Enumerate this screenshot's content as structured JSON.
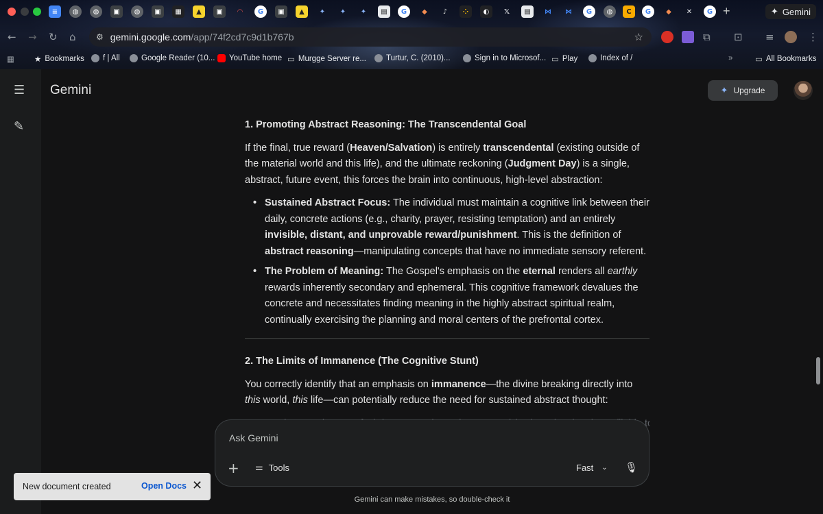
{
  "browser": {
    "active_tab_title": "Gemini",
    "url_host": "gemini.google.com",
    "url_path": "/app/74f2cd7c9d1b767b",
    "bookmarks": [
      {
        "label": "Bookmarks",
        "icon": "star-icon"
      },
      {
        "label": "f | All",
        "icon": "globe-icon"
      },
      {
        "label": "Google Reader (10...",
        "icon": "globe-icon"
      },
      {
        "label": "YouTube home",
        "icon": "youtube-icon"
      },
      {
        "label": "Murgge Server re...",
        "icon": "folder-icon"
      },
      {
        "label": "Turtur, C. (2010)...",
        "icon": "globe-icon"
      },
      {
        "label": "Sign in to Microsof...",
        "icon": "globe-icon"
      },
      {
        "label": "Play",
        "icon": "folder-icon"
      },
      {
        "label": "Index of /",
        "icon": "globe-icon"
      }
    ],
    "all_bookmarks_label": "All Bookmarks"
  },
  "app": {
    "brand": "Gemini",
    "upgrade_label": "Upgrade"
  },
  "response": {
    "section1": {
      "heading": "1. Promoting Abstract Reasoning: The Transcendental Goal",
      "p_a": "If the final, true reward (",
      "p_b": "Heaven/Salvation",
      "p_c": ") is entirely ",
      "p_d": "transcendental",
      "p_e": " (existing outside of the material world and this life), and the ultimate reckoning (",
      "p_f": "Judgment Day",
      "p_g": ") is a single, abstract, future event, this forces the brain into continuous, high-level abstraction:",
      "b1_title": "Sustained Abstract Focus:",
      "b1_a": " The individual must maintain a cognitive link between their daily, concrete actions (e.g., charity, prayer, resisting temptation) and an entirely ",
      "b1_b": "invisible, distant, and unprovable reward/punishment",
      "b1_c": ". This is the definition of ",
      "b1_d": "abstract reasoning",
      "b1_e": "—manipulating concepts that have no immediate sensory referent.",
      "b2_title": "The Problem of Meaning:",
      "b2_a": " The Gospel's emphasis on the ",
      "b2_b": "eternal",
      "b2_c": " renders all ",
      "b2_d": "earthly",
      "b2_e": " rewards inherently secondary and ephemeral. This cognitive framework devalues the concrete and necessitates finding meaning in the highly abstract spiritual realm, continually exercising the planning and moral centers of the prefrontal cortex."
    },
    "section2": {
      "heading": "2. The Limits of Immanence (The Cognitive Stunt)",
      "p_a": "You correctly identify that an emphasis on ",
      "p_b": "immanence",
      "p_c": "—the divine breaking directly into ",
      "p_d": "this",
      "p_e": " world, ",
      "p_f": "this",
      "p_g": " life—can potentially reduce the need for sustained abstract thought:",
      "faded_line": "Imminent Judgment: If Christ's return (or Judgment Day) is viewed as imminent (liable to"
    }
  },
  "input": {
    "placeholder": "Ask Gemini",
    "tools_label": "Tools",
    "mode_label": "Fast",
    "disclaimer": "Gemini can make mistakes, so double-check it"
  },
  "toast": {
    "message": "New document created",
    "action_label": "Open Docs"
  },
  "colors": {
    "background": "#131314",
    "rail": "#1b1c1d",
    "text": "#e3e3e3",
    "toast_action": "#0b57d0"
  }
}
